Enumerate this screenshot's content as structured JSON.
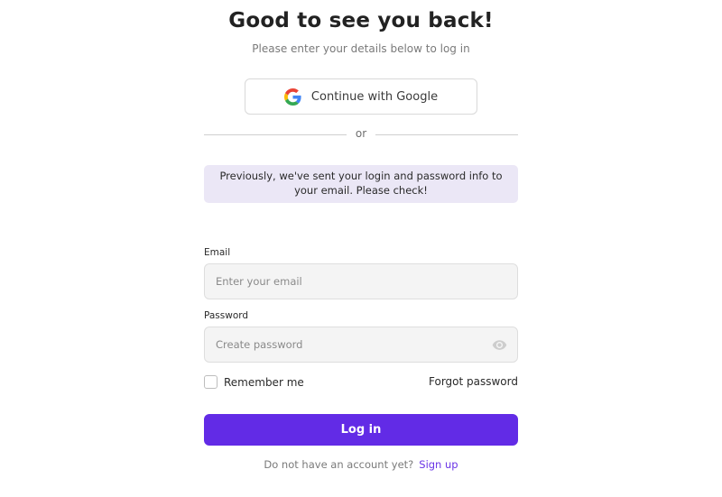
{
  "header": {
    "title": "Good to see you back!",
    "subtitle": "Please enter your details below to log in"
  },
  "google": {
    "label": "Continue with Google",
    "icon": "google-icon"
  },
  "divider": {
    "text": "or"
  },
  "notice": {
    "text": "Previously, we've sent your login and password info to your email. Please check!"
  },
  "email": {
    "label": "Email",
    "placeholder": "Enter your email",
    "value": ""
  },
  "password": {
    "label": "Password",
    "placeholder": "Create password",
    "value": "",
    "toggle_icon": "eye-icon"
  },
  "options": {
    "remember_label": "Remember me",
    "remember_checked": false,
    "forgot_label": "Forgot password"
  },
  "actions": {
    "login_label": "Log in"
  },
  "footer": {
    "prompt": "Do not have an account yet?",
    "signup_label": "Sign up"
  },
  "colors": {
    "primary": "#622be6",
    "link": "#6a34e6",
    "notice_bg": "#ebe7f6",
    "input_bg": "#f4f4f4"
  }
}
